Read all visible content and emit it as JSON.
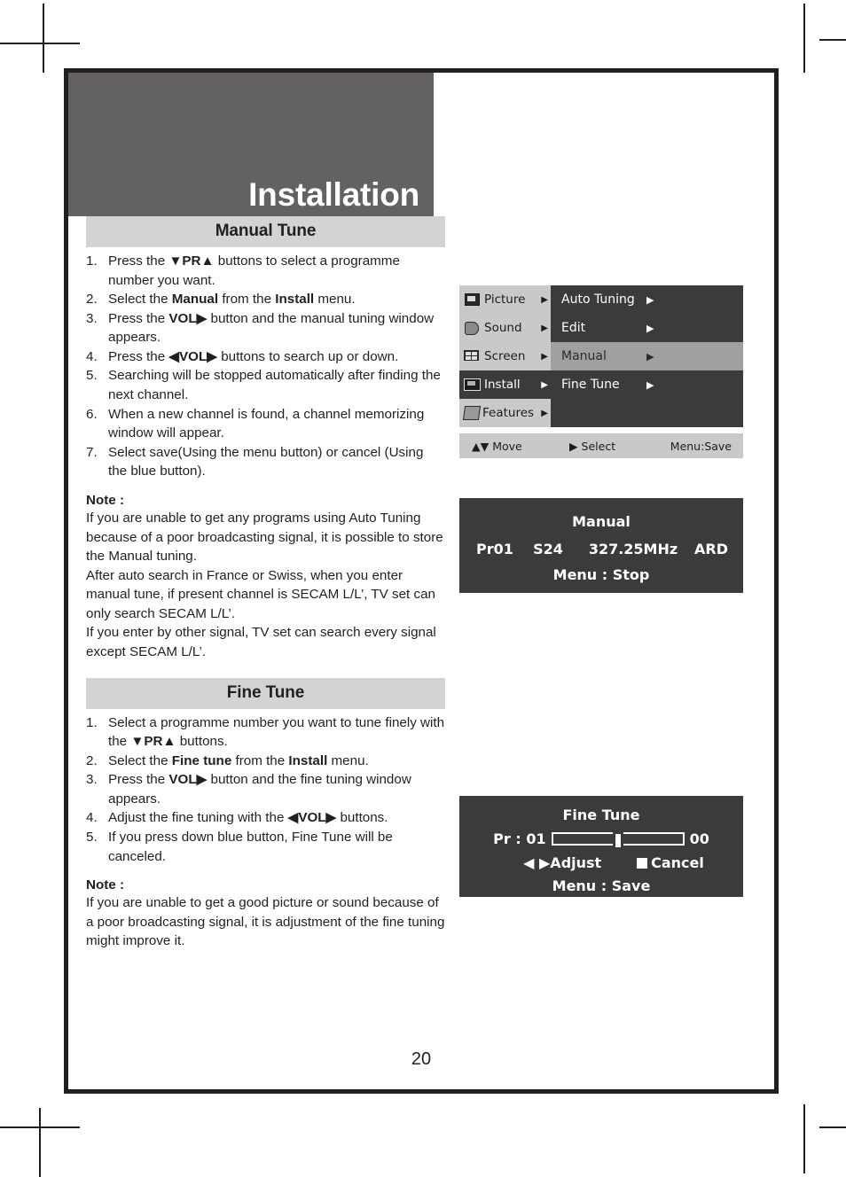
{
  "page": {
    "title": "Installation",
    "number": "20"
  },
  "sections": [
    {
      "id": "manual-tune",
      "heading": "Manual Tune",
      "steps": [
        {
          "n": "1.",
          "html": "Press the <b>▼PR▲</b> buttons to select a programme number you want."
        },
        {
          "n": "2.",
          "html": "Select the <b>Manual</b> from the <b>Install</b> menu."
        },
        {
          "n": "3.",
          "html": "Press the <b>VOL▶</b> button and the manual tuning window appears."
        },
        {
          "n": "4.",
          "html": "Press the <b>◀VOL▶</b> buttons to search up or down."
        },
        {
          "n": "5.",
          "html": "Searching will be stopped automatically after finding the next channel."
        },
        {
          "n": "6.",
          "html": "When a new channel is found, a channel memorizing window will appear."
        },
        {
          "n": "7.",
          "html": "Select save(Using the menu button) or cancel (Using the blue button)."
        }
      ],
      "note_label": "Note :",
      "note_lines": [
        "If you are unable to get any programs using Auto Tuning because of a poor broadcasting signal, it is possible to store the Manual tuning.",
        "After auto search in France or Swiss, when you enter manual tune, if present channel is SECAM L/L’, TV set can only search SECAM L/L’.",
        "If you enter by other signal, TV set can search every signal except SECAM L/L’."
      ]
    },
    {
      "id": "fine-tune",
      "heading": "Fine Tune",
      "steps": [
        {
          "n": "1.",
          "html": "Select a programme number you want to tune finely with the <b>▼PR▲</b> buttons."
        },
        {
          "n": "2.",
          "html": "Select the <b>Fine tune</b> from the <b>Install</b> menu."
        },
        {
          "n": "3.",
          "html": "Press the <b>VOL▶</b> button and the fine tuning window appears."
        },
        {
          "n": "4.",
          "html": "Adjust the fine tuning with the <b>◀VOL▶</b> buttons."
        },
        {
          "n": "5.",
          "html": "If you press down blue button, Fine Tune will be canceled."
        }
      ],
      "note_label": "Note :",
      "note_lines": [
        "If you are unable to get a good picture or sound because of a poor broadcasting signal, it is adjustment of the fine tuning might improve it."
      ]
    }
  ],
  "osd_menu": {
    "left_items": [
      {
        "label": "Picture",
        "icon": "picture-icon",
        "selected": false,
        "arrow": "▶"
      },
      {
        "label": "Sound",
        "icon": "sound-icon",
        "selected": false,
        "arrow": "▶"
      },
      {
        "label": "Screen",
        "icon": "screen-icon",
        "selected": false,
        "arrow": "▶"
      },
      {
        "label": "Install",
        "icon": "install-icon",
        "selected": true,
        "arrow": "▶"
      },
      {
        "label": "Features",
        "icon": "features-icon",
        "selected": false,
        "arrow": "▶"
      }
    ],
    "right_items": [
      {
        "label": "Auto Tuning",
        "selected": false,
        "arrow": "▶"
      },
      {
        "label": "Edit",
        "selected": false,
        "arrow": "▶"
      },
      {
        "label": "Manual",
        "selected": true,
        "arrow": "▶"
      },
      {
        "label": "Fine Tune",
        "selected": false,
        "arrow": "▶"
      }
    ],
    "statusbar": {
      "move": "▲▼ Move",
      "select": "▶  Select",
      "save": "Menu:Save"
    },
    "colors": {
      "panel_dark": "#3b3b3b",
      "panel_light": "#c9c9c9",
      "highlight": "#a0a0a0"
    }
  },
  "osd_manual": {
    "title": "Manual",
    "programme": "Pr01",
    "channel": "S24",
    "frequency": "327.25MHz",
    "system": "ARD",
    "footer": "Menu : Stop"
  },
  "osd_fine": {
    "title": "Fine Tune",
    "programme_label": "Pr : 01",
    "value": "00",
    "slider_percent": 50,
    "adjust_label": "◀ ▶Adjust",
    "cancel_label": "Cancel",
    "footer": "Menu : Save"
  }
}
